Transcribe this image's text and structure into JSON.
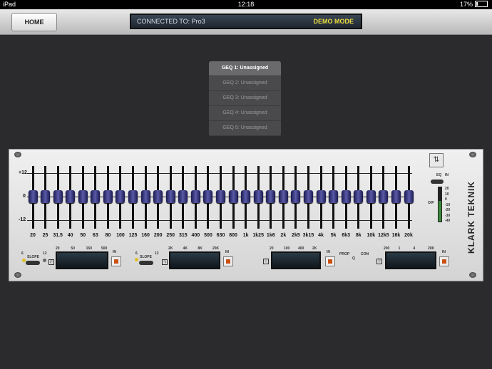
{
  "status": {
    "device": "iPad",
    "time": "12:18",
    "battery": "17%"
  },
  "header": {
    "home_label": "HOME",
    "connected_label": "CONNECTED TO: Pro3",
    "mode_label": "DEMO MODE"
  },
  "menu": {
    "items": [
      "GEQ 1: Unassigned",
      "GEQ 2: Unassigned",
      "GEQ 3: Unassigned",
      "GEQ 4: Unassigned",
      "GEQ 5: Unassigned"
    ],
    "selected_index": 0
  },
  "eq": {
    "scale": {
      "top": "+12",
      "mid": "0",
      "bottom": "-12"
    },
    "frequencies": [
      "20",
      "25",
      "31.5",
      "40",
      "50",
      "63",
      "80",
      "100",
      "125",
      "160",
      "200",
      "250",
      "315",
      "400",
      "500",
      "630",
      "800",
      "1k",
      "1k25",
      "1k6",
      "2k",
      "2k5",
      "3k15",
      "4k",
      "5k",
      "6k3",
      "8k",
      "10k",
      "12k5",
      "16k",
      "20k"
    ],
    "gains_db": [
      0,
      0,
      0,
      0,
      0,
      0,
      0,
      0,
      0,
      0,
      0,
      0,
      0,
      0,
      0,
      0,
      0,
      0,
      0,
      0,
      0,
      0,
      0,
      0,
      0,
      0,
      0,
      0,
      0,
      0,
      0
    ]
  },
  "brand": "KLARK TEKNIK",
  "panel": {
    "eq_label": "EQ",
    "in_label": "IN",
    "op_label": "O/P",
    "meter_scale": [
      "20",
      "10",
      "0",
      "-10",
      "-20",
      "-30",
      "-40"
    ],
    "hpf": {
      "slope_label": "SLOPE",
      "slope_6": "6",
      "slope_12": "12",
      "scale": [
        "20",
        "50",
        "150",
        "500"
      ],
      "in_label": "IN"
    },
    "lpf": {
      "slope_label": "SLOPE",
      "slope_6": "6",
      "slope_12": "12",
      "scale": [
        "2K",
        "4K",
        "8K",
        "20K"
      ],
      "in_label": "IN"
    },
    "param1": {
      "scale": [
        "20",
        "100",
        "400",
        "2K"
      ],
      "in_label": "IN",
      "prop_label": "PROP",
      "q_label": "Q",
      "con_label": "CON"
    },
    "param2": {
      "scale": [
        "200",
        "1",
        "4",
        "20K"
      ],
      "in_label": "IN"
    }
  },
  "colors": {
    "accent": "#f0e040",
    "knob": "#4a4aa0",
    "in_led": "#c85010"
  }
}
